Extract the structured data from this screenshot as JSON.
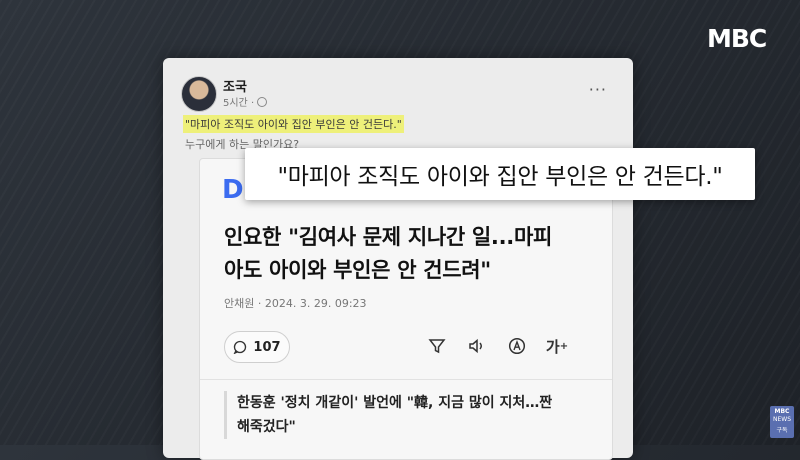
{
  "broadcast": {
    "logo": "MBC",
    "badge_top": "MBC",
    "badge_mid": "NEWS",
    "badge_bottom": "구독"
  },
  "post": {
    "author": "조국",
    "time": "5시간 ·",
    "highlight_quote": "\"마피아 조직도 아이와 집안 부인은 안 건든다.\"",
    "subtext": "누구에게 하는 말인가요?",
    "menu_label": "···"
  },
  "article": {
    "source_logo": "D",
    "headline_line1": "인요한 \"김여사 문제 지나간 일...마피",
    "headline_line2": "아도 아이와 부인은 안 건드려\"",
    "byline": "안채원 · 2024. 3. 29. 09:23",
    "comment_count": "107",
    "font_tool_label": "가",
    "related_line1": "한동훈 '정치 개같이' 발언에 \"韓, 지금 많이 지처…짠",
    "related_line2": "해죽겄다\""
  },
  "caption": {
    "text": "\"마피아 조직도 아이와 집안 부인은 안 건든다.\""
  },
  "colors": {
    "highlight": "#eef07a",
    "accent_blue": "#3d78ee"
  },
  "icons": [
    "globe-icon",
    "more-icon",
    "comment-icon",
    "filter-icon",
    "speaker-icon",
    "translate-icon",
    "font-size-icon"
  ]
}
